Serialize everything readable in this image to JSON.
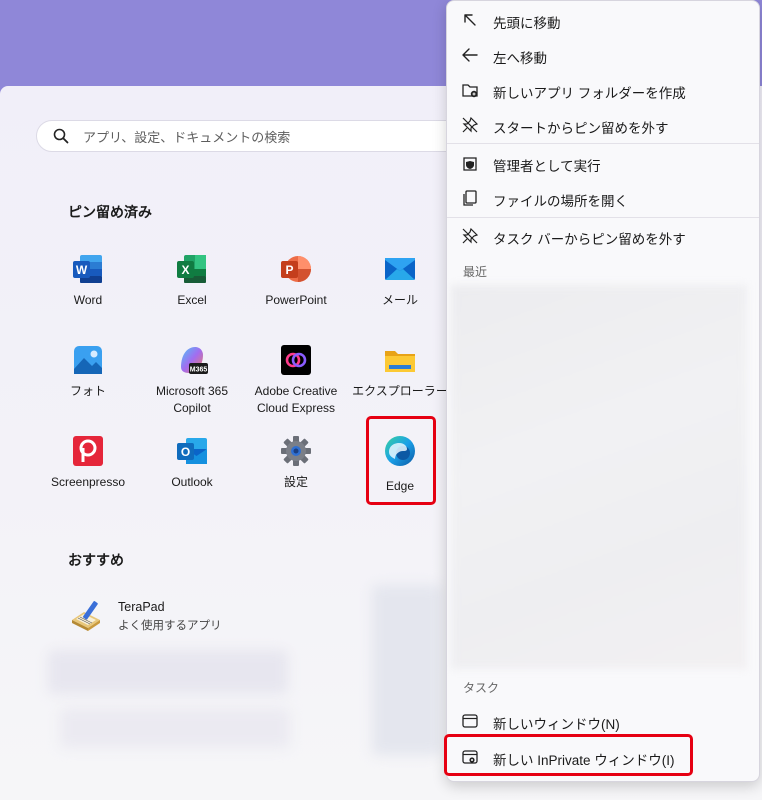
{
  "search": {
    "placeholder": "アプリ、設定、ドキュメントの検索"
  },
  "pinned": {
    "title": "ピン留め済み",
    "apps": [
      {
        "label": "Word",
        "icon": "word-icon"
      },
      {
        "label": "Excel",
        "icon": "excel-icon"
      },
      {
        "label": "PowerPoint",
        "icon": "powerpoint-icon"
      },
      {
        "label": "メール",
        "icon": "mail-icon"
      },
      {
        "label": "フォト",
        "icon": "photos-icon"
      },
      {
        "label": "Microsoft 365\nCopilot",
        "icon": "m365-copilot-icon",
        "badge": "M365"
      },
      {
        "label": "Adobe Creative\nCloud Express",
        "icon": "adobe-express-icon"
      },
      {
        "label": "エクスプローラー",
        "icon": "file-explorer-icon"
      },
      {
        "label": "Screenpresso",
        "icon": "screenpresso-icon"
      },
      {
        "label": "Outlook",
        "icon": "outlook-icon"
      },
      {
        "label": "設定",
        "icon": "settings-gear-icon"
      },
      {
        "label": "Edge",
        "icon": "edge-icon"
      }
    ]
  },
  "recommended": {
    "title": "おすすめ",
    "items": [
      {
        "name": "TeraPad",
        "subtitle": "よく使用するアプリ",
        "icon": "terapad-icon"
      }
    ]
  },
  "context_menu": {
    "items": [
      {
        "label": "先頭に移動",
        "icon": "arrow-up-left-icon"
      },
      {
        "label": "左へ移動",
        "icon": "arrow-left-icon"
      },
      {
        "label": "新しいアプリ フォルダーを作成",
        "icon": "new-folder-icon"
      },
      {
        "label": "スタートからピン留めを外す",
        "icon": "unpin-icon"
      },
      {
        "label": "管理者として実行",
        "icon": "shield-icon"
      },
      {
        "label": "ファイルの場所を開く",
        "icon": "file-copy-icon"
      },
      {
        "label": "タスク バーからピン留めを外す",
        "icon": "unpin-icon"
      }
    ],
    "recent_heading": "最近",
    "tasks_heading": "タスク",
    "tasks": [
      {
        "label": "新しいウィンドウ(N)",
        "icon": "window-icon"
      },
      {
        "label": "新しい InPrivate ウィンドウ(I)",
        "icon": "inprivate-window-icon"
      }
    ]
  },
  "colors": {
    "highlight": "#e60012",
    "desktop": "#8f87d8"
  }
}
